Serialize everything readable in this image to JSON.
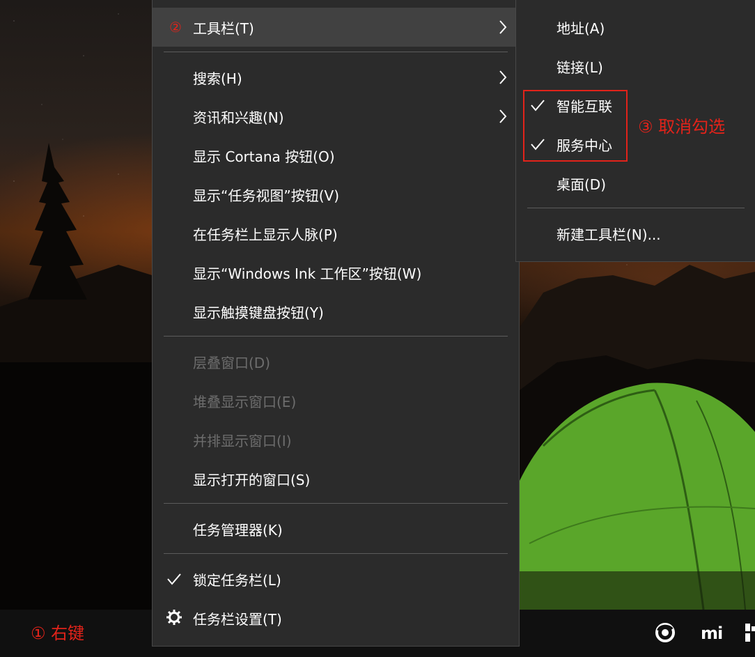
{
  "taskbar": {
    "annotation": "① 右键",
    "tray": [
      "baidu-icon",
      "mi-icon",
      "app-icon"
    ]
  },
  "main_menu": {
    "toolbar": {
      "number": "②",
      "label": "工具栏(T)"
    },
    "search": "搜索(H)",
    "news": "资讯和兴趣(N)",
    "cortana": "显示 Cortana 按钮(O)",
    "task_view": "显示“任务视图”按钮(V)",
    "people": "在任务栏上显示人脉(P)",
    "ink": "显示“Windows Ink 工作区”按钮(W)",
    "touch_keyboard": "显示触摸键盘按钮(Y)",
    "cascade": "层叠窗口(D)",
    "stack": "堆叠显示窗口(E)",
    "side_by_side": "并排显示窗口(I)",
    "show_desktop": "显示打开的窗口(S)",
    "task_manager": "任务管理器(K)",
    "lock": "锁定任务栏(L)",
    "settings": "任务栏设置(T)"
  },
  "sub_menu": {
    "address": "地址(A)",
    "links": "链接(L)",
    "smart_link": "智能互联",
    "service_center": "服务中心",
    "desktop": "桌面(D)",
    "new_toolbar": "新建工具栏(N)..."
  },
  "annotation3": "③ 取消勾选",
  "colors": {
    "menu_bg": "#2b2b2b",
    "hover_bg": "#414141",
    "disabled_text": "#6d6d6d",
    "annotation_red": "#e2231a"
  }
}
